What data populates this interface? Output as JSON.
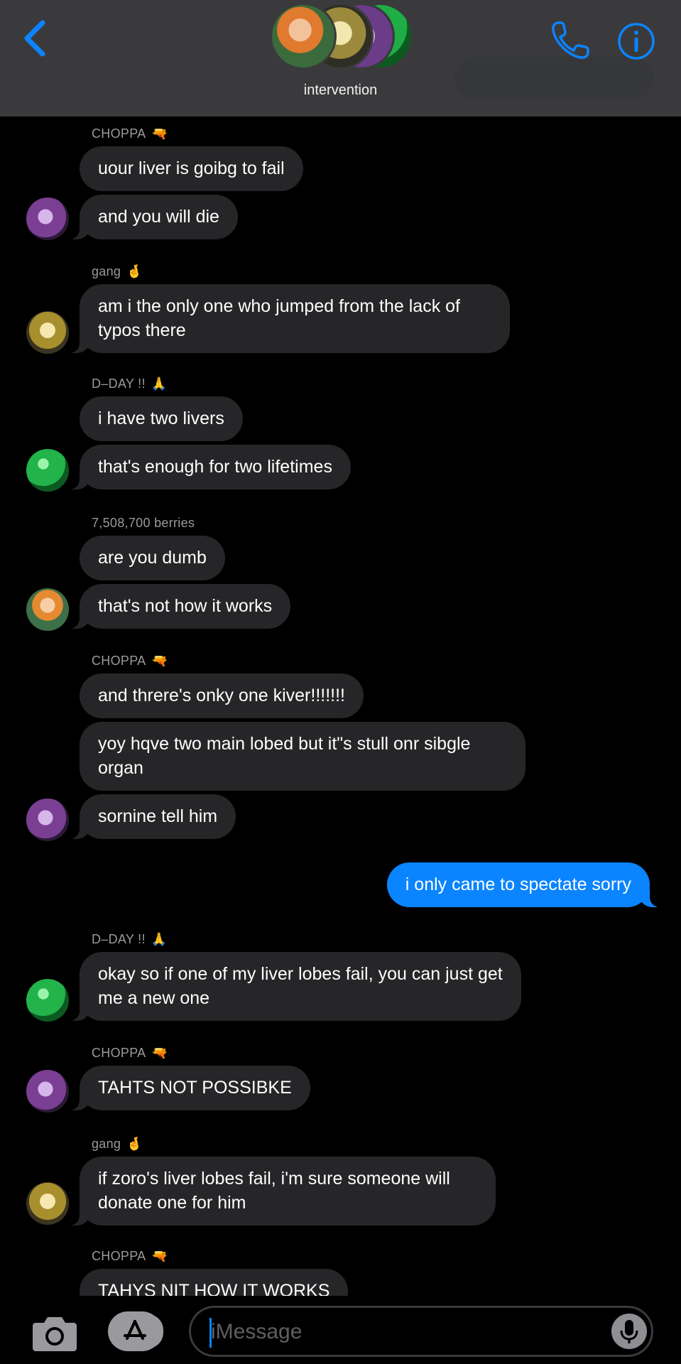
{
  "header": {
    "title": "intervention",
    "back_icon": "chevron-left-icon",
    "call_icon": "phone-icon",
    "info_icon": "info-icon"
  },
  "messages": [
    {
      "sender": "CHOPPA",
      "sender_emoji": "🔫",
      "texts": [
        "uour liver is goibg to fail",
        "and you will die"
      ]
    },
    {
      "sender": "gang",
      "sender_emoji": "🤞",
      "texts": [
        "am i the only one who jumped from the lack of typos there"
      ]
    },
    {
      "sender": "D–DAY !!",
      "sender_emoji": "🙏",
      "texts": [
        "i have two livers",
        "that's enough for two lifetimes"
      ]
    },
    {
      "sender": "7,508,700 berries",
      "sender_emoji": "",
      "texts": [
        "are you dumb",
        "that's not how it works"
      ]
    },
    {
      "sender": "CHOPPA",
      "sender_emoji": "🔫",
      "texts": [
        "and threre's onky one kiver!!!!!!!",
        "yoy hqve two main lobed but it\"s stull onr sibgle organ",
        "sornine tell him"
      ]
    },
    {
      "sender": "me",
      "texts": [
        "i only came to spectate sorry"
      ]
    },
    {
      "sender": "D–DAY !!",
      "sender_emoji": "🙏",
      "texts": [
        "okay so if one of my liver lobes fail, you can just get me a new one"
      ]
    },
    {
      "sender": "CHOPPA",
      "sender_emoji": "🔫",
      "texts": [
        "TAHTS NOT POSSIBKE"
      ]
    },
    {
      "sender": "gang",
      "sender_emoji": "🤞",
      "texts": [
        "if zoro's liver lobes fail, i'm sure someone will donate one for him"
      ]
    },
    {
      "sender": "CHOPPA",
      "sender_emoji": "🔫",
      "texts": [
        "TAHYS NIT HOW IT WORKS"
      ]
    }
  ],
  "composer": {
    "placeholder": "iMessage",
    "camera_icon": "camera-icon",
    "apps_icon": "app-store-icon",
    "mic_icon": "microphone-icon"
  },
  "colors": {
    "background": "#000000",
    "header": "#3a3a3c",
    "incoming_bubble": "#262628",
    "outgoing_bubble": "#0a84ff",
    "accent": "#0a84ff"
  }
}
